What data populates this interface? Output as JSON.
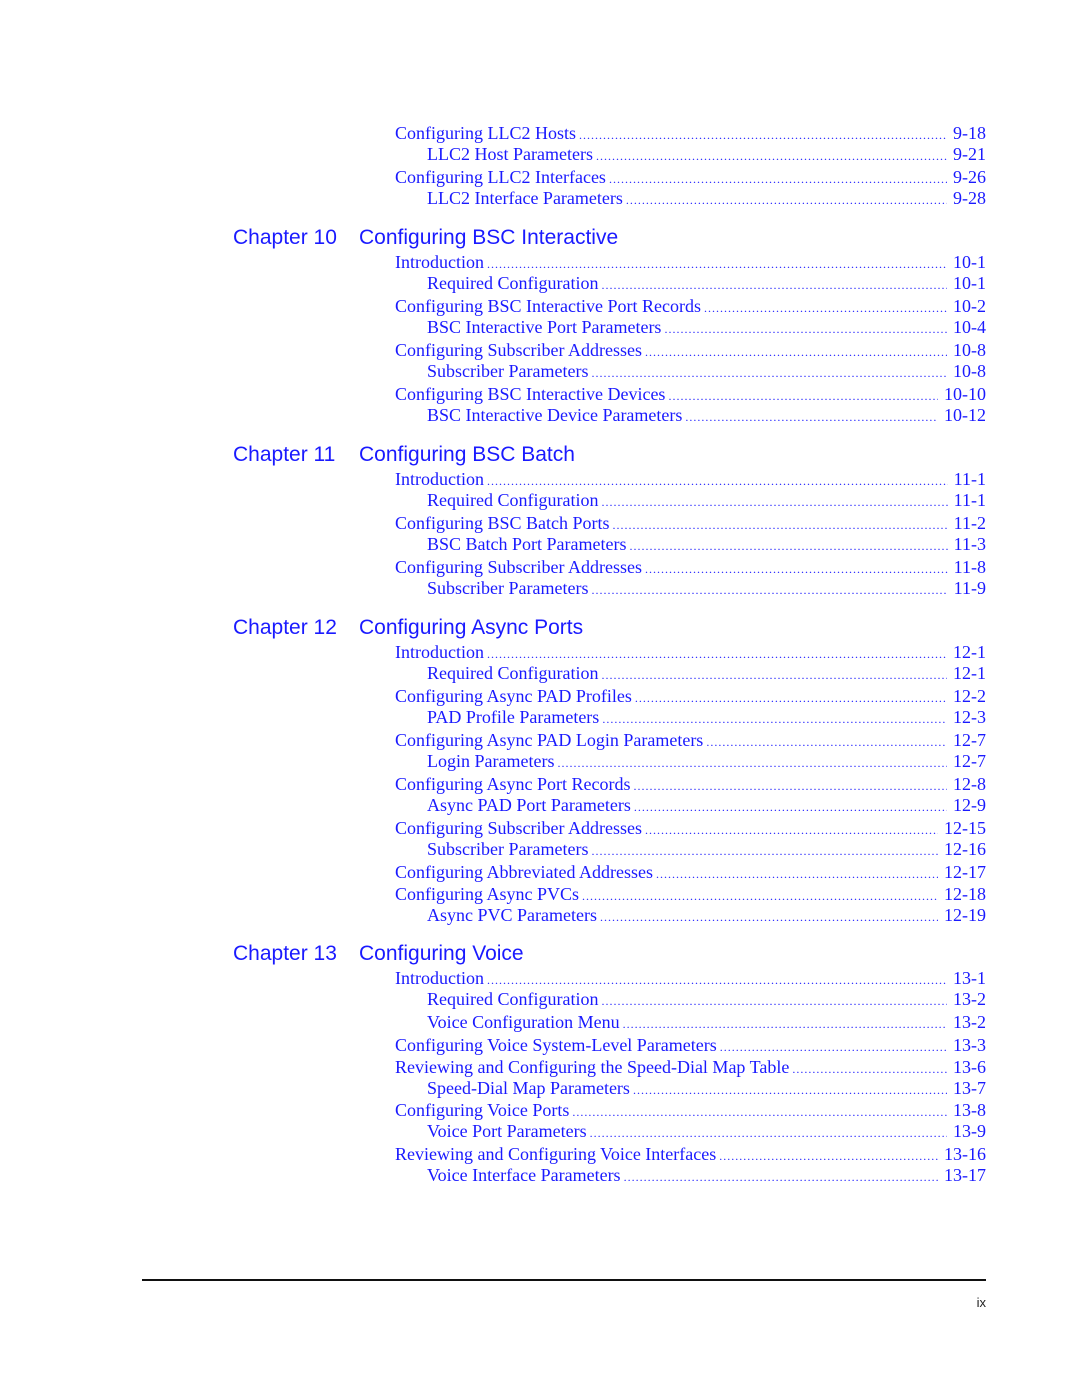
{
  "toc": {
    "pre_entries": [
      {
        "title": "Configuring LLC2 Hosts",
        "page": "9-18",
        "level": 1
      },
      {
        "title": "LLC2 Host Parameters",
        "page": "9-21",
        "level": 2
      },
      {
        "title": "Configuring LLC2 Interfaces",
        "page": "9-26",
        "level": 1
      },
      {
        "title": "LLC2 Interface Parameters",
        "page": "9-28",
        "level": 2
      }
    ],
    "chapters": [
      {
        "label": "Chapter 10",
        "title": "Configuring BSC Interactive",
        "entries": [
          {
            "title": "Introduction",
            "page": "10-1",
            "level": 1
          },
          {
            "title": "Required Configuration",
            "page": "10-1",
            "level": 2
          },
          {
            "title": "Configuring BSC Interactive Port Records",
            "page": "10-2",
            "level": 1
          },
          {
            "title": "BSC Interactive Port Parameters",
            "page": "10-4",
            "level": 2
          },
          {
            "title": "Configuring Subscriber Addresses",
            "page": "10-8",
            "level": 1
          },
          {
            "title": "Subscriber Parameters",
            "page": "10-8",
            "level": 2
          },
          {
            "title": "Configuring BSC Interactive Devices",
            "page": "10-10",
            "level": 1
          },
          {
            "title": "BSC Interactive Device Parameters",
            "page": "10-12",
            "level": 2
          }
        ]
      },
      {
        "label": "Chapter 11",
        "title": "Configuring BSC Batch",
        "entries": [
          {
            "title": "Introduction",
            "page": "11-1",
            "level": 1
          },
          {
            "title": "Required Configuration",
            "page": "11-1",
            "level": 2
          },
          {
            "title": "Configuring BSC Batch Ports",
            "page": "11-2",
            "level": 1
          },
          {
            "title": "BSC Batch Port Parameters",
            "page": "11-3",
            "level": 2
          },
          {
            "title": "Configuring Subscriber Addresses",
            "page": "11-8",
            "level": 1
          },
          {
            "title": "Subscriber Parameters",
            "page": "11-9",
            "level": 2
          }
        ]
      },
      {
        "label": "Chapter 12",
        "title": "Configuring Async Ports",
        "entries": [
          {
            "title": "Introduction",
            "page": "12-1",
            "level": 1
          },
          {
            "title": "Required Configuration",
            "page": "12-1",
            "level": 2
          },
          {
            "title": "Configuring Async PAD Profiles",
            "page": "12-2",
            "level": 1
          },
          {
            "title": "PAD Profile Parameters",
            "page": "12-3",
            "level": 2
          },
          {
            "title": "Configuring Async PAD Login Parameters",
            "page": "12-7",
            "level": 1
          },
          {
            "title": "Login Parameters",
            "page": "12-7",
            "level": 2
          },
          {
            "title": "Configuring Async Port Records",
            "page": "12-8",
            "level": 1
          },
          {
            "title": "Async PAD Port Parameters",
            "page": "12-9",
            "level": 2
          },
          {
            "title": "Configuring Subscriber Addresses",
            "page": "12-15",
            "level": 1
          },
          {
            "title": "Subscriber Parameters",
            "page": "12-16",
            "level": 2
          },
          {
            "title": "Configuring Abbreviated Addresses",
            "page": "12-17",
            "level": 1
          },
          {
            "title": "Configuring Async PVCs",
            "page": "12-18",
            "level": 1
          },
          {
            "title": "Async PVC Parameters",
            "page": "12-19",
            "level": 2
          }
        ]
      },
      {
        "label": "Chapter 13",
        "title": "Configuring Voice",
        "entries": [
          {
            "title": "Introduction",
            "page": "13-1",
            "level": 1
          },
          {
            "title": "Required Configuration",
            "page": "13-2",
            "level": 2
          },
          {
            "title": "Voice Configuration Menu",
            "page": "13-2",
            "level": 2
          },
          {
            "title": "Configuring Voice System-Level Parameters",
            "page": "13-3",
            "level": 1
          },
          {
            "title": "Reviewing and Configuring the Speed-Dial Map Table",
            "page": "13-6",
            "level": 1
          },
          {
            "title": "Speed-Dial Map Parameters",
            "page": "13-7",
            "level": 2
          },
          {
            "title": "Configuring Voice Ports",
            "page": "13-8",
            "level": 1
          },
          {
            "title": "Voice Port Parameters",
            "page": "13-9",
            "level": 2
          },
          {
            "title": "Reviewing and Configuring Voice Interfaces",
            "page": "13-16",
            "level": 1
          },
          {
            "title": "Voice Interface Parameters",
            "page": "13-17",
            "level": 2
          }
        ]
      }
    ]
  },
  "footer": {
    "page_number": "ix"
  },
  "colors": {
    "link": "#1a1aff",
    "rule": "#111111"
  }
}
